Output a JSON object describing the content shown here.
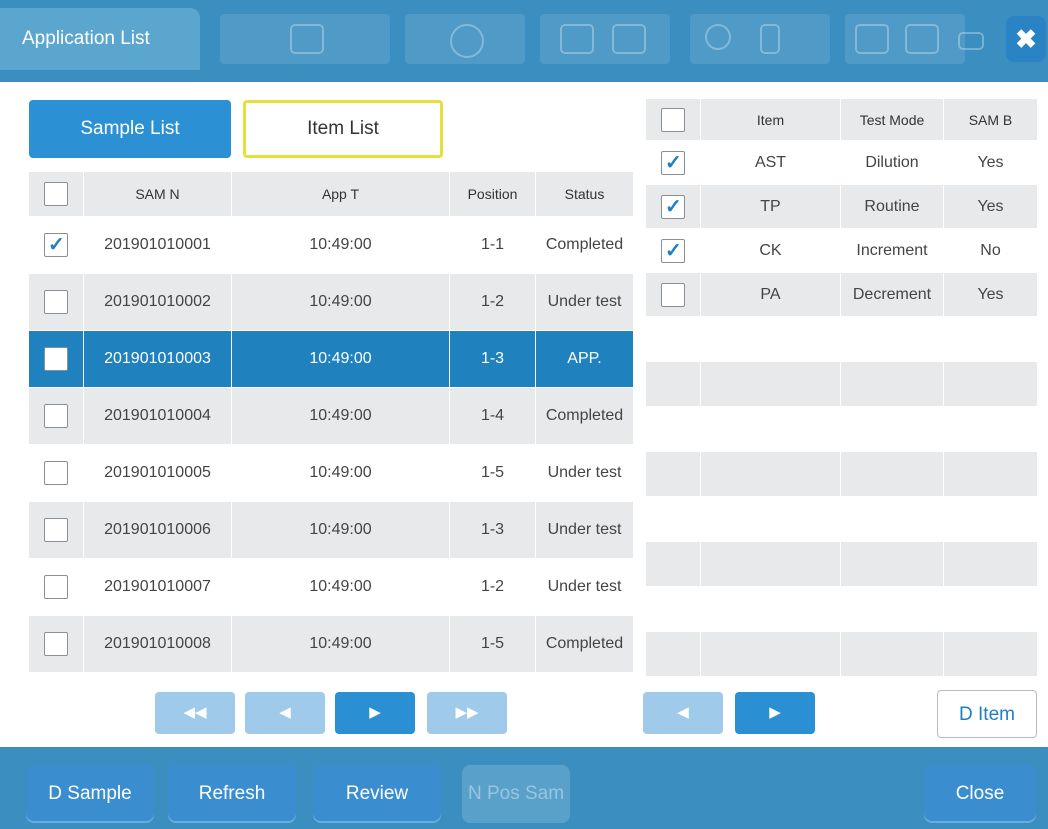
{
  "window": {
    "title": "Application List"
  },
  "toggle": {
    "sample_list": "Sample List",
    "item_list": "Item List"
  },
  "sample_table": {
    "headers": [
      "SAM N",
      "App T",
      "Position",
      "Status"
    ],
    "rows": [
      {
        "sample_no": "201901010001",
        "app_time": "10:49:00",
        "position": "1-1",
        "status": "Completed",
        "checked": true
      },
      {
        "sample_no": "201901010002",
        "app_time": "10:49:00",
        "position": "1-2",
        "status": "Under test",
        "checked": false
      },
      {
        "sample_no": "201901010003",
        "app_time": "10:49:00",
        "position": "1-3",
        "status": "APP.",
        "checked": false,
        "selected": true
      },
      {
        "sample_no": "201901010004",
        "app_time": "10:49:00",
        "position": "1-4",
        "status": "Completed",
        "checked": false
      },
      {
        "sample_no": "201901010005",
        "app_time": "10:49:00",
        "position": "1-5",
        "status": "Under test",
        "checked": false
      },
      {
        "sample_no": "201901010006",
        "app_time": "10:49:00",
        "position": "1-3",
        "status": "Under test",
        "checked": false
      },
      {
        "sample_no": "201901010007",
        "app_time": "10:49:00",
        "position": "1-2",
        "status": "Under test",
        "checked": false
      },
      {
        "sample_no": "201901010008",
        "app_time": "10:49:00",
        "position": "1-5",
        "status": "Completed",
        "checked": false
      }
    ]
  },
  "item_table": {
    "headers": [
      "Item",
      "Test Mode",
      "SAM B"
    ],
    "rows": [
      {
        "item": "AST",
        "mode": "Dilution",
        "sam_b": "Yes",
        "checked": true
      },
      {
        "item": "TP",
        "mode": "Routine",
        "sam_b": "Yes",
        "checked": true
      },
      {
        "item": "CK",
        "mode": "Increment",
        "sam_b": "No",
        "checked": true
      },
      {
        "item": "PA",
        "mode": "Decrement",
        "sam_b": "Yes",
        "checked": false
      }
    ]
  },
  "pagination": {
    "first": "◀◀",
    "prev": "◀",
    "next": "▶",
    "last": "▶▶"
  },
  "d_item_button": "D Item",
  "bottom": {
    "d_sample": "D Sample",
    "refresh": "Refresh",
    "review": "Review",
    "n_pos_sam": "N Pos Sam",
    "close": "Close"
  },
  "colors": {
    "bar": "#3b8fc0",
    "accent": "#2b90d4",
    "selected_row": "#1f81bd",
    "item_list_border": "#e7df3c"
  }
}
